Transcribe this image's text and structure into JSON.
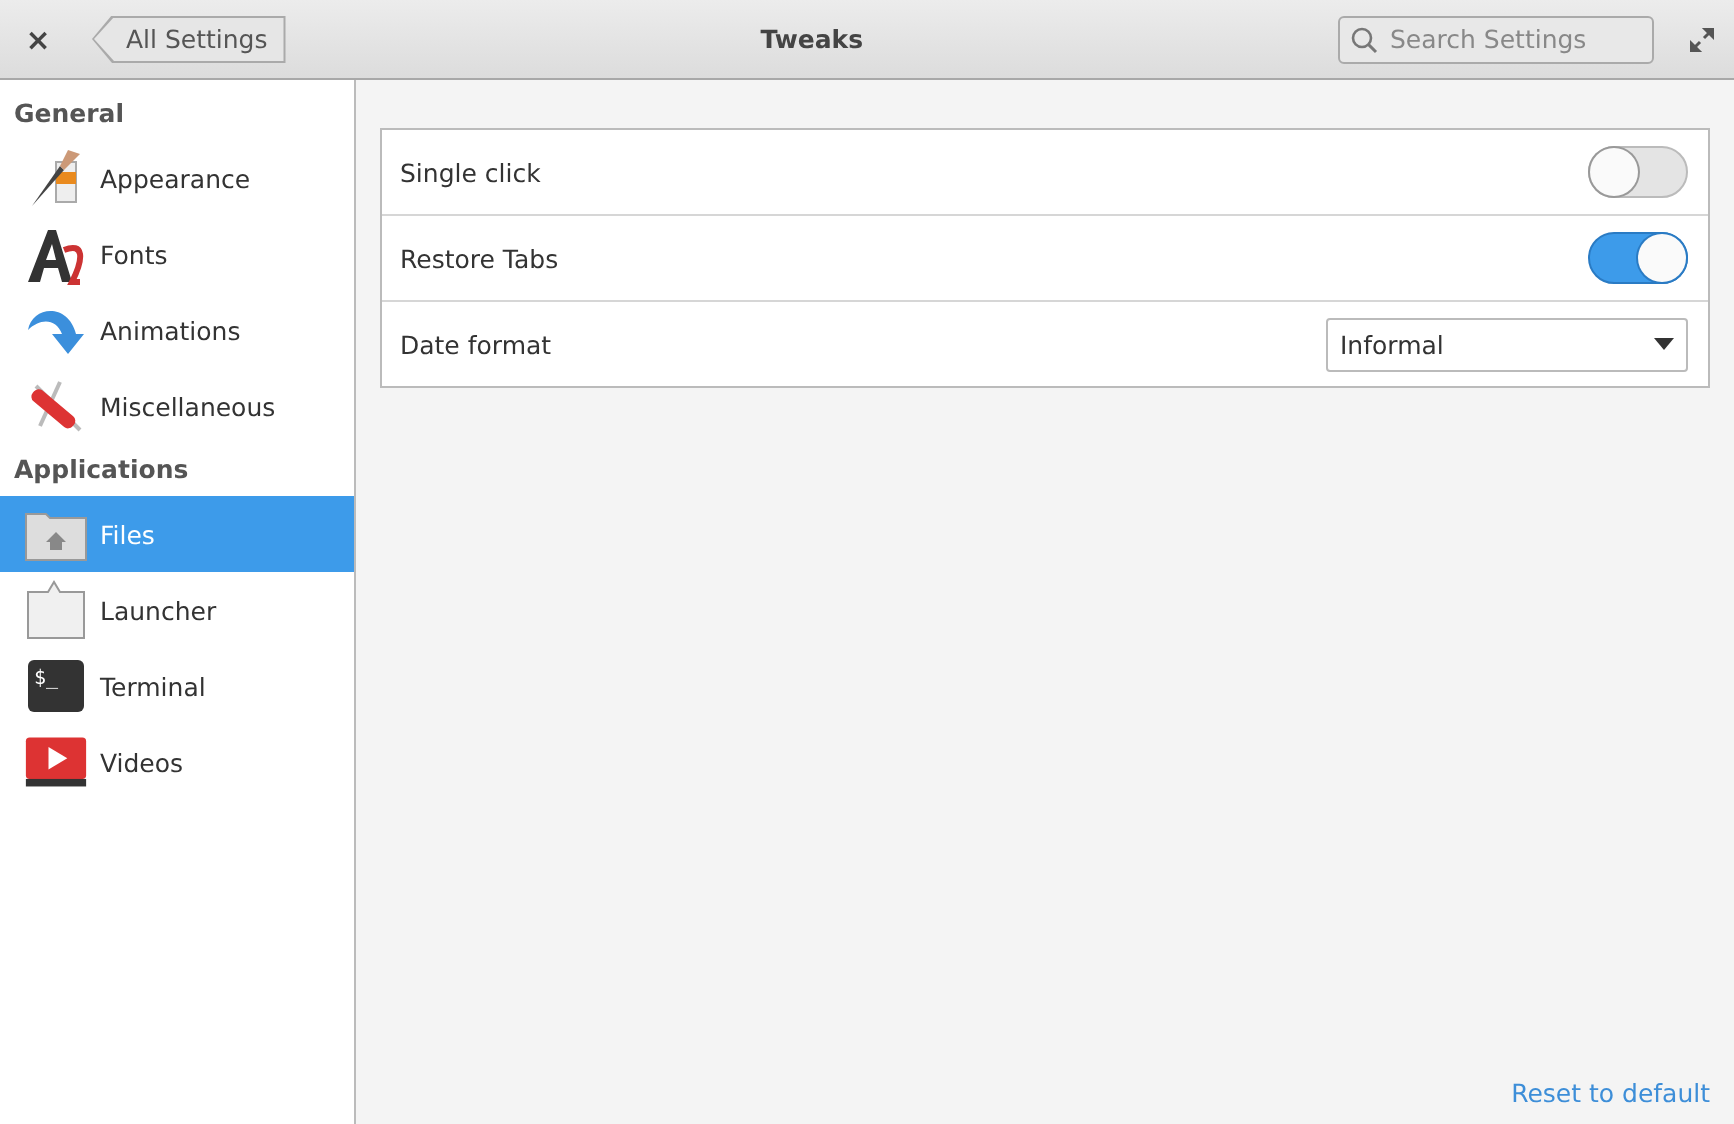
{
  "window": {
    "title": "Tweaks",
    "close": "×",
    "back_button": "All Settings",
    "search": {
      "placeholder": "Search Settings"
    }
  },
  "sidebar": {
    "sections": [
      {
        "heading": "General",
        "items": [
          {
            "label": "Appearance",
            "selected": false
          },
          {
            "label": "Fonts",
            "selected": false
          },
          {
            "label": "Animations",
            "selected": false
          },
          {
            "label": "Miscellaneous",
            "selected": false
          }
        ]
      },
      {
        "heading": "Applications",
        "items": [
          {
            "label": "Files",
            "selected": true
          },
          {
            "label": "Launcher",
            "selected": false
          },
          {
            "label": "Terminal",
            "selected": false,
            "icon_text": "$_"
          },
          {
            "label": "Videos",
            "selected": false
          }
        ]
      }
    ]
  },
  "settings": [
    {
      "kind": "switch",
      "label": "Single click",
      "on": false
    },
    {
      "kind": "switch",
      "label": "Restore Tabs",
      "on": true
    },
    {
      "kind": "dropdown",
      "label": "Date format",
      "value": "Informal"
    }
  ],
  "footer_link": "Reset to default"
}
